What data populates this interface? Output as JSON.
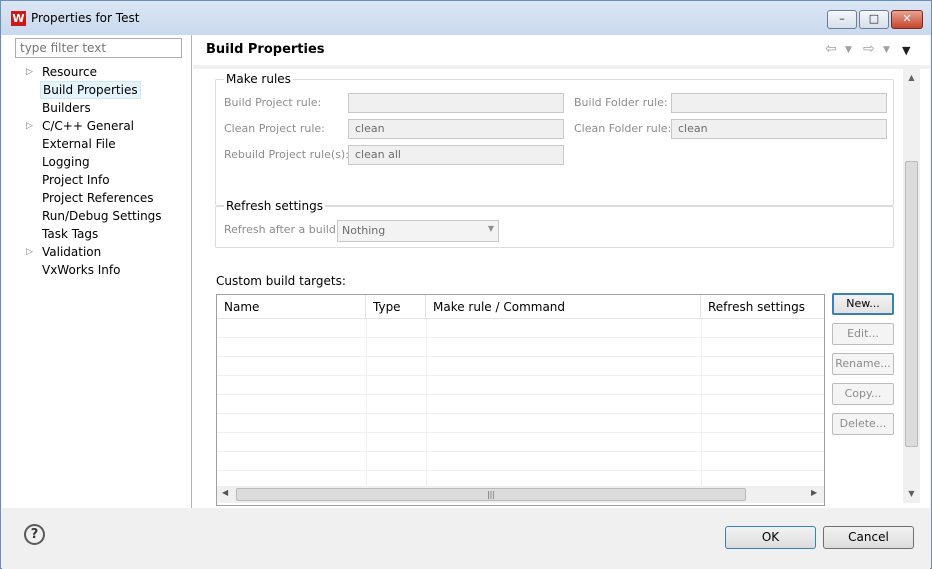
{
  "window": {
    "title": "Properties for Test",
    "logo_letter": "W"
  },
  "sidebar": {
    "filter_placeholder": "type filter text",
    "items": [
      {
        "label": "Resource",
        "expandable": true
      },
      {
        "label": "Build Properties",
        "selected": true
      },
      {
        "label": "Builders"
      },
      {
        "label": "C/C++ General",
        "expandable": true
      },
      {
        "label": "External File"
      },
      {
        "label": "Logging"
      },
      {
        "label": "Project Info"
      },
      {
        "label": "Project References"
      },
      {
        "label": "Run/Debug Settings"
      },
      {
        "label": "Task Tags"
      },
      {
        "label": "Validation",
        "expandable": true
      },
      {
        "label": "VxWorks Info"
      }
    ]
  },
  "page": {
    "title": "Build Properties"
  },
  "make_rules": {
    "title": "Make rules",
    "build_project_label": "Build Project rule:",
    "build_project_value": "",
    "build_folder_label": "Build Folder rule:",
    "build_folder_value": "",
    "clean_project_label": "Clean Project rule:",
    "clean_project_value": "clean",
    "clean_folder_label": "Clean Folder rule:",
    "clean_folder_value": "clean",
    "rebuild_project_label": "Rebuild Project rule(s):",
    "rebuild_project_value": "clean all"
  },
  "refresh": {
    "title": "Refresh settings",
    "after_build_label": "Refresh after a build:",
    "after_build_value": "Nothing"
  },
  "targets": {
    "label": "Custom build targets:",
    "columns": [
      "Name",
      "Type",
      "Make rule / Command",
      "Refresh settings"
    ],
    "rows": []
  },
  "target_buttons": {
    "new": "New...",
    "edit": "Edit...",
    "rename": "Rename...",
    "copy": "Copy...",
    "delete": "Delete..."
  },
  "footer": {
    "help": "?",
    "ok": "OK",
    "cancel": "Cancel"
  }
}
